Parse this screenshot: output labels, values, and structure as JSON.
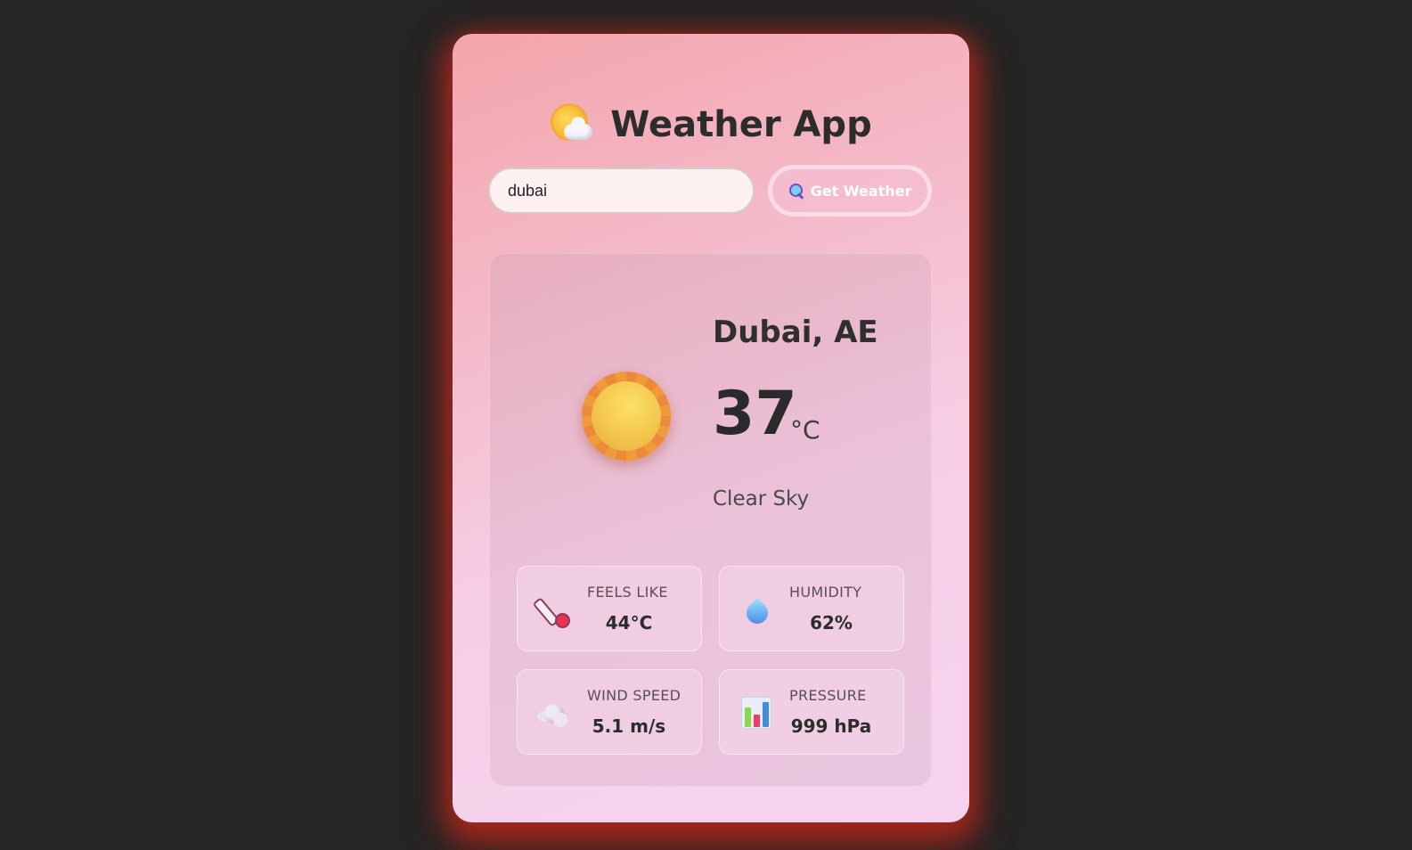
{
  "app": {
    "title": "Weather App",
    "title_icon": "sun-behind-cloud-icon"
  },
  "search": {
    "value": "dubai",
    "button_label": "Get Weather",
    "button_icon": "search-icon"
  },
  "weather": {
    "icon": "sun-icon",
    "city": "Dubai, AE",
    "temperature": "37",
    "unit": "°C",
    "description": "Clear Sky"
  },
  "stats": [
    {
      "icon": "thermometer-icon",
      "label": "FEELS LIKE",
      "value": "44°C"
    },
    {
      "icon": "water-drop-icon",
      "label": "HUMIDITY",
      "value": "62%"
    },
    {
      "icon": "wind-icon",
      "label": "WIND SPEED",
      "value": "5.1 m/s"
    },
    {
      "icon": "bar-chart-icon",
      "label": "PRESSURE",
      "value": "999 hPa"
    }
  ],
  "colors": {
    "page_background": "#252525",
    "card_gradient_start": "#f3a4aa",
    "card_gradient_end": "#f7d3ef",
    "card_glow": "#be281e",
    "text_primary": "#2c2c2c"
  }
}
